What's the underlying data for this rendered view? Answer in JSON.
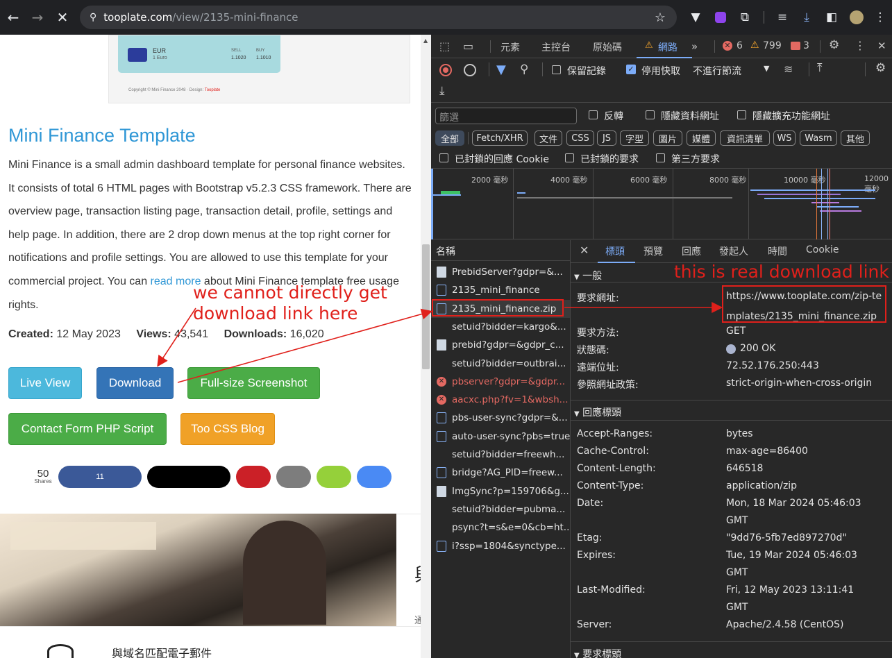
{
  "browser": {
    "url_host": "tooplate.com",
    "url_path": "/view/2135-mini-finance",
    "icons": [
      "back-icon",
      "forward-icon",
      "stop-icon",
      "site-info-icon",
      "star-icon",
      "vpn-icon",
      "extension-icon",
      "puzzle-icon",
      "media-icon",
      "download-icon",
      "sidebar-icon",
      "avatar"
    ]
  },
  "page": {
    "preview": {
      "currency": "EUR",
      "currency_sub": "1 Euro",
      "sell_label": "SELL",
      "buy_label": "BUY",
      "sell_value": "1.1020",
      "buy_value": "1.1010",
      "footer": "Copyright © Mini Finance 2048 · Design: ",
      "footer_link": "Tooplate"
    },
    "title": "Mini Finance Template",
    "description_before": "Mini Finance is a small admin dashboard template for personal finance websites. It consists of total 6 HTML pages with Bootstrap v5.2.3 CSS framework. There are overview page, transaction listing page, transaction detail, profile, settings and help page. In addition, there are 2 drop down menus at the top right corner for notifications and profile settings. You are allowed to use this template for your commercial project. You can ",
    "description_link": "read more",
    "description_after": " about Mini Finance template free usage rights.",
    "stats": {
      "created_label": "Created:",
      "created_value": " 12 May 2023",
      "views_label": "Views:",
      "views_value": " 43,541",
      "downloads_label": "Downloads:",
      "downloads_value": " 16,020"
    },
    "buttons": {
      "live_view": "Live View",
      "download": "Download",
      "screenshot": "Full-size Screenshot",
      "contact_form": "Contact Form PHP Script",
      "css_blog": "Too CSS Blog"
    },
    "share": {
      "count": "50",
      "label": "Shares",
      "facebook_count": "11"
    },
    "ad_text": "與域名匹配電子郵件",
    "ad_side_char": "與",
    "ad_side_char2": "通"
  },
  "annotations": {
    "left_note_line1": "we cannot directly get",
    "left_note_line2": "download link here",
    "right_note": "this is real download link"
  },
  "devtools": {
    "tabs": [
      "元素",
      "主控台",
      "原始碼",
      "網路"
    ],
    "errors": "6",
    "warnings": "799",
    "issues": "3",
    "toolbar": {
      "preserve_log": "保留記錄",
      "disable_cache": "停用快取",
      "throttle": "不進行節流"
    },
    "filter_placeholder": "篩選",
    "filter_opts": {
      "invert": "反轉",
      "hide_data": "隱藏資料網址",
      "hide_ext": "隱藏擴充功能網址"
    },
    "type_chips": [
      "全部",
      "Fetch/XHR",
      "文件",
      "CSS",
      "JS",
      "字型",
      "圖片",
      "媒體",
      "資訊清單",
      "WS",
      "Wasm",
      "其他"
    ],
    "blocked": {
      "blocked_cookies": "已封鎖的回應 Cookie",
      "blocked_requests": "已封鎖的要求",
      "third_party": "第三方要求"
    },
    "timeline_ticks": [
      "2000 毫秒",
      "4000 毫秒",
      "6000 毫秒",
      "8000 毫秒",
      "10000 毫秒",
      "12000 毫秒"
    ],
    "name_header": "名稱",
    "requests": [
      {
        "name": "PrebidServer?gdpr=&...",
        "type": "img",
        "error": false,
        "selected": false
      },
      {
        "name": "2135_mini_finance",
        "type": "doc",
        "error": false,
        "selected": false
      },
      {
        "name": "2135_mini_finance.zip",
        "type": "doc",
        "error": false,
        "selected": true
      },
      {
        "name": "setuid?bidder=kargo&...",
        "type": "none",
        "error": false,
        "selected": false
      },
      {
        "name": "prebid?gdpr=&gdpr_c...",
        "type": "img",
        "error": false,
        "selected": false
      },
      {
        "name": "setuid?bidder=outbrai...",
        "type": "none",
        "error": false,
        "selected": false
      },
      {
        "name": "pbserver?gdpr=&gdpr...",
        "type": "err",
        "error": true,
        "selected": false
      },
      {
        "name": "aacxc.php?fv=1&wbsh...",
        "type": "err",
        "error": true,
        "selected": false
      },
      {
        "name": "pbs-user-sync?gdpr=&...",
        "type": "doc",
        "error": false,
        "selected": false
      },
      {
        "name": "auto-user-sync?pbs=true",
        "type": "doc",
        "error": false,
        "selected": false
      },
      {
        "name": "setuid?bidder=freewh...",
        "type": "none",
        "error": false,
        "selected": false
      },
      {
        "name": "bridge?AG_PID=freew...",
        "type": "doc",
        "error": false,
        "selected": false
      },
      {
        "name": "ImgSync?p=159706&g...",
        "type": "img",
        "error": false,
        "selected": false
      },
      {
        "name": "setuid?bidder=pubma...",
        "type": "none",
        "error": false,
        "selected": false
      },
      {
        "name": "psync?t=s&e=0&cb=ht...",
        "type": "none",
        "error": false,
        "selected": false
      },
      {
        "name": "i?ssp=1804&synctype...",
        "type": "doc",
        "error": false,
        "selected": false
      }
    ],
    "detail_tabs": [
      "標頭",
      "預覽",
      "回應",
      "發起人",
      "時間",
      "Cookie"
    ],
    "general_title": "一般",
    "general": [
      {
        "k": "要求網址:",
        "v": "https://www.tooplate.com/zip-te"
      },
      {
        "k": "要求方法:",
        "v": "GET"
      },
      {
        "k": "狀態碼:",
        "v": "200 OK"
      },
      {
        "k": "遠端位址:",
        "v": "72.52.176.250:443"
      },
      {
        "k": "參照網址政策:",
        "v": "strict-origin-when-cross-origin"
      }
    ],
    "url_line2": "mplates/2135_mini_finance.zip",
    "response_title": "回應標頭",
    "response": [
      {
        "k": "Accept-Ranges:",
        "v": "bytes"
      },
      {
        "k": "Cache-Control:",
        "v": "max-age=86400"
      },
      {
        "k": "Content-Length:",
        "v": "646518"
      },
      {
        "k": "Content-Type:",
        "v": "application/zip"
      },
      {
        "k": "Date:",
        "v": "Mon, 18 Mar 2024 05:46:03",
        "v2": "GMT"
      },
      {
        "k": "Etag:",
        "v": "\"9dd76-5fb7ed897270d\""
      },
      {
        "k": "Expires:",
        "v": "Tue, 19 Mar 2024 05:46:03",
        "v2": "GMT"
      },
      {
        "k": "Last-Modified:",
        "v": "Fri, 12 May 2023 13:11:41",
        "v2": "GMT"
      },
      {
        "k": "Server:",
        "v": "Apache/2.4.58 (CentOS)"
      }
    ],
    "request_title": "要求標頭"
  },
  "colors": {
    "accent_blue": "#2f97d6",
    "annotation_red": "#e0201b",
    "devtools_bg": "#282828"
  }
}
